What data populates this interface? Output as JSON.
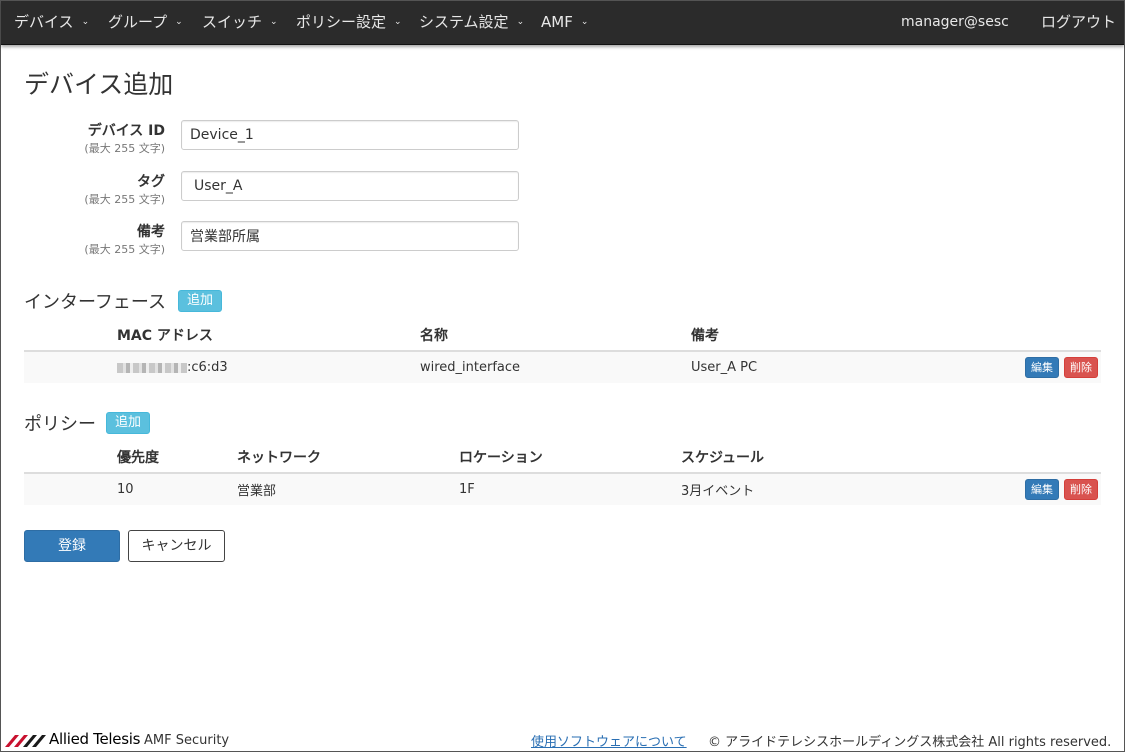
{
  "navbar": {
    "menus": [
      {
        "label": "デバイス"
      },
      {
        "label": "グループ"
      },
      {
        "label": "スイッチ"
      },
      {
        "label": "ポリシー設定"
      },
      {
        "label": "システム設定"
      },
      {
        "label": "AMF"
      }
    ],
    "user": "manager@sesc",
    "logout": "ログアウト"
  },
  "page": {
    "title": "デバイス追加"
  },
  "form": {
    "device_id": {
      "label": "デバイス ID",
      "hint": "(最大 255 文字)",
      "value": "Device_1"
    },
    "tag": {
      "label": "タグ",
      "hint": "(最大 255 文字)",
      "value": "User_A"
    },
    "note": {
      "label": "備考",
      "hint": "(最大 255 文字)",
      "value": "営業部所属"
    }
  },
  "interfaces": {
    "heading": "インターフェース",
    "add_label": "追加",
    "columns": [
      "MAC アドレス",
      "名称",
      "備考"
    ],
    "rows": [
      {
        "mac_suffix": ":c6:d3",
        "name": "wired_interface",
        "note": "User_A PC",
        "edit": "編集",
        "delete": "削除"
      }
    ]
  },
  "policies": {
    "heading": "ポリシー",
    "add_label": "追加",
    "columns": [
      "優先度",
      "ネットワーク",
      "ロケーション",
      "スケジュール"
    ],
    "rows": [
      {
        "priority": "10",
        "network": "営業部",
        "location": "1F",
        "schedule": "3月イベント",
        "edit": "編集",
        "delete": "削除"
      }
    ]
  },
  "actions": {
    "register": "登録",
    "cancel": "キャンセル"
  },
  "footer": {
    "brand": "Allied Telesis",
    "product": "AMF Security",
    "software_link": "使用ソフトウェアについて",
    "copyright": "© アライドテレシスホールディングス株式会社 All rights reserved."
  },
  "colors": {
    "navbar_bg": "#2b2b2b",
    "primary": "#337ab7",
    "info": "#5bc0de",
    "danger": "#d9534f"
  },
  "icons": [
    "chevron-down-icon",
    "allied-telesis-logo"
  ]
}
